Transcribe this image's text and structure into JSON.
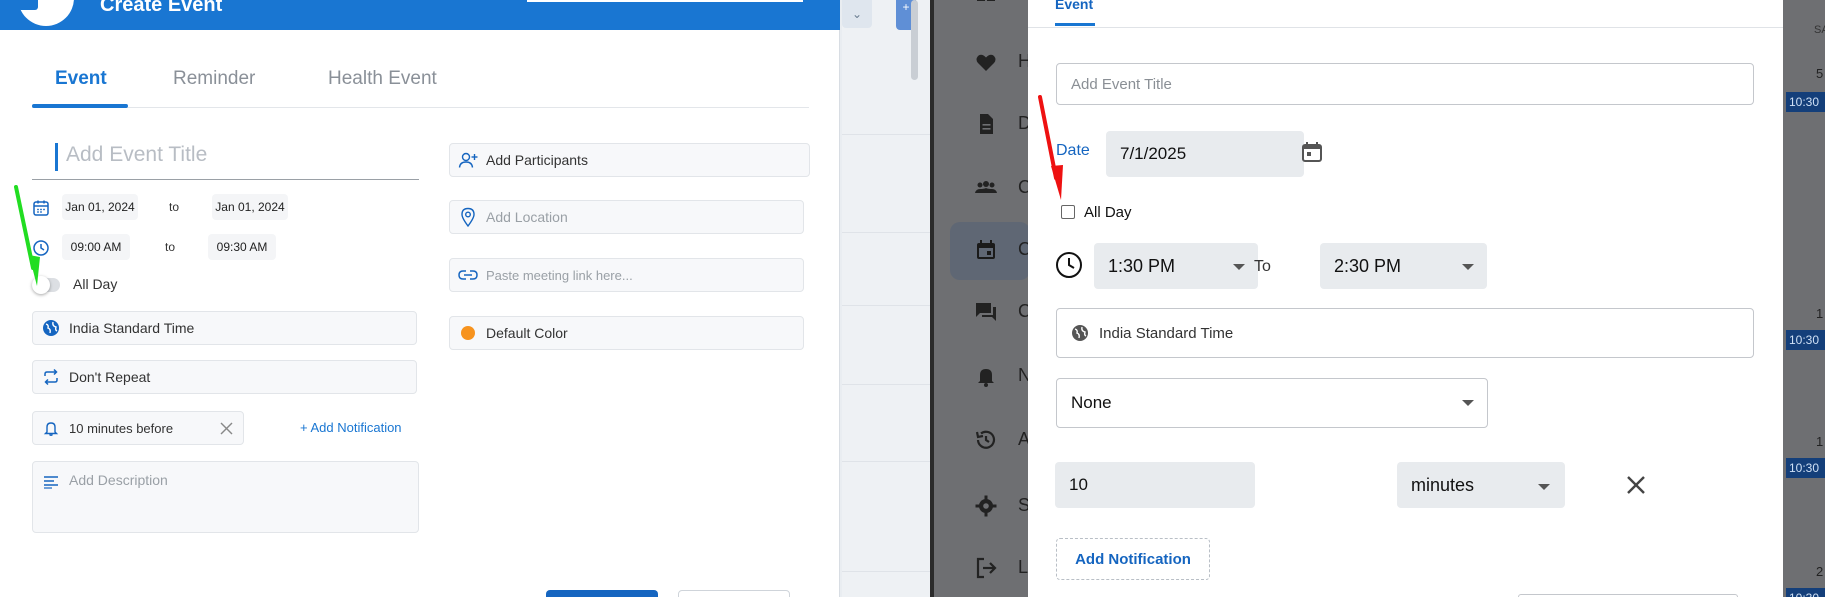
{
  "left": {
    "header": {
      "title": "Create Event"
    },
    "tabs": [
      {
        "label": "Event"
      },
      {
        "label": "Reminder"
      },
      {
        "label": "Health Event"
      }
    ],
    "title_placeholder": "Add Event Title",
    "start_date": "Jan 01, 2024",
    "end_date": "Jan 01, 2024",
    "date_sep": "to",
    "start_time": "09:00 AM",
    "end_time": "09:30 AM",
    "time_sep": "to",
    "all_day": {
      "label": "All Day",
      "checked": false
    },
    "timezone": "India Standard Time",
    "repeat": "Don't Repeat",
    "notification": "10 minutes before",
    "add_notification": "+ Add Notification",
    "description_placeholder": "Add Description",
    "participants": "Add Participants",
    "location_placeholder": "Add Location",
    "meeting_link_placeholder": "Paste meeting link here...",
    "color": {
      "label": "Default Color",
      "value": "#f7931e"
    }
  },
  "right": {
    "tab": "Event",
    "title_placeholder": "Add Event Title",
    "date_label": "Date",
    "date_value": "7/1/2025",
    "all_day": {
      "label": "All Day",
      "checked": false
    },
    "start_time": "1:30 PM",
    "time_sep": "To",
    "end_time": "2:30 PM",
    "timezone": "India Standard Time",
    "repeat": "None",
    "reminder_value": "10",
    "reminder_unit": "minutes",
    "add_notification": "Add Notification",
    "sidebar_letters": [
      "H",
      "D",
      "C",
      "C",
      "C",
      "N",
      "A",
      "S",
      "L"
    ],
    "calendar": {
      "day_header": "SA",
      "numbers": [
        "5",
        "1",
        "1",
        "2"
      ],
      "event_time": "10:30"
    }
  },
  "colors": {
    "accent": "#1976d2",
    "green_arrow": "#22dd22",
    "red_arrow": "#ee1111"
  }
}
